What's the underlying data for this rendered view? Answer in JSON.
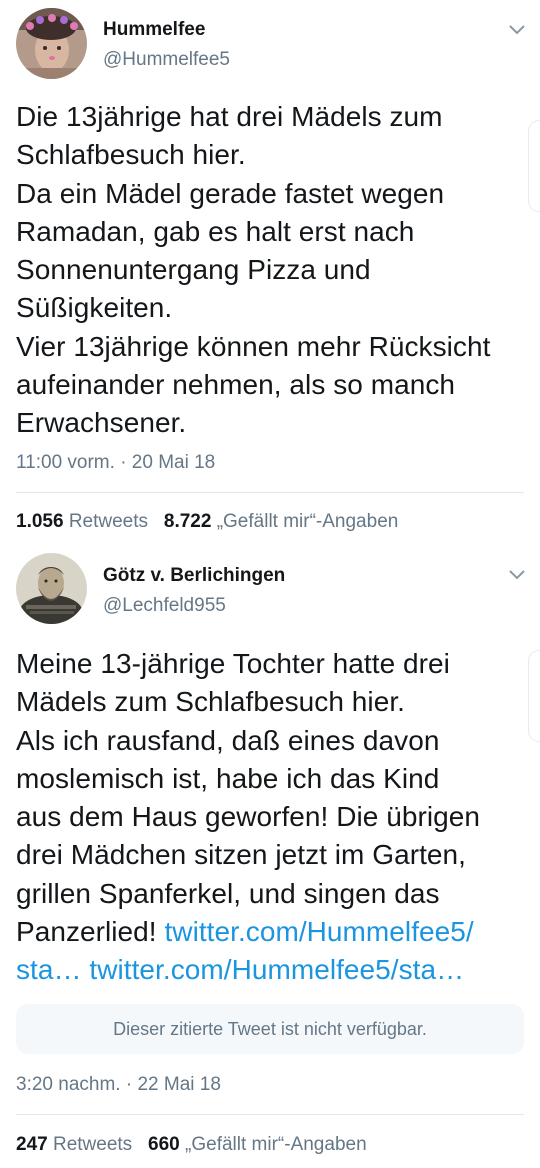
{
  "tweets": [
    {
      "display_name": "Hummelfee",
      "handle": "@Hummelfee5",
      "avatar": "avatar-woman-flower-crown",
      "menu_icon": "chevron-down-icon",
      "body_lines": [
        "Die 13jährige hat drei Mädels zum",
        "Schlafbesuch hier.",
        "Da ein Mädel gerade fastet wegen",
        "Ramadan, gab es halt erst nach",
        "Sonnenuntergang Pizza und",
        "Süßigkeiten.",
        "Vier 13jährige können mehr Rücksicht",
        "aufeinander nehmen, als so manch",
        "Erwachsener."
      ],
      "timestamp": "11:00 vorm. · 20 Mai 18",
      "retweet_count": "1.056",
      "retweet_label": "Retweets",
      "like_count": "8.722",
      "like_label": "„Gefällt mir“-Angaben"
    },
    {
      "display_name": "Götz v. Berlichingen",
      "handle": "@Lechfeld955",
      "avatar": "avatar-knight-portrait",
      "menu_icon": "chevron-down-icon",
      "body_lines": [
        "Meine 13-jährige Tochter hatte drei",
        "Mädels zum Schlafbesuch hier.",
        "Als ich rausfand, daß eines davon",
        "moslemisch ist, habe ich das Kind",
        "aus dem Haus geworfen! Die übrigen",
        "drei Mädchen sitzen jetzt im Garten,",
        "grillen Spanferkel, und singen das"
      ],
      "body_last_line_text": "Panzerlied! ",
      "link_1": "twitter.com/Hummelfee5/",
      "link_2": "sta… twitter.com/Hummelfee5/sta…",
      "quoted_unavailable": "Dieser zitierte Tweet ist nicht verfügbar.",
      "timestamp": "3:20 nachm. · 22 Mai 18",
      "retweet_count": "247",
      "retweet_label": "Retweets",
      "like_count": "660",
      "like_label": "„Gefällt mir“-Angaben"
    }
  ],
  "colors": {
    "text": "#14171a",
    "secondary": "#657786",
    "link": "#1b95e0",
    "divider": "#e1e8ed",
    "quote_bg": "#f5f8fa"
  }
}
